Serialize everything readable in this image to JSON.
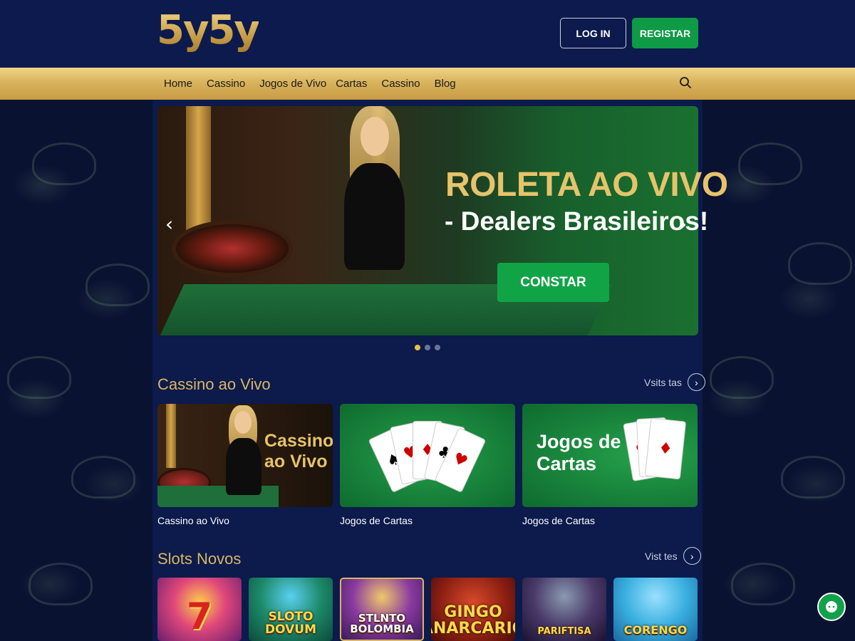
{
  "header": {
    "logo": "5y5y",
    "login_label": "LOG IN",
    "register_label": "REGISTAR"
  },
  "nav": {
    "items": [
      "Home",
      "Cassino",
      "Jogos de Vivo",
      "Cartas",
      "Cassino",
      "Blog"
    ]
  },
  "hero": {
    "title_line1": "ROLETA AO VIVO",
    "title_line2": "- Dealers Brasileiros!",
    "cta_label": "CONSTAR",
    "slides_count": 3,
    "active_slide": 1
  },
  "live_section": {
    "title": "Cassino ao Vivo",
    "view_all": "Vsits tas",
    "cards": [
      {
        "overlay": "Cassino\nao Vivo",
        "label": "Cassino ao Vivo"
      },
      {
        "overlay": "",
        "label": "Jogos de Cartas"
      },
      {
        "overlay": "Jogos de\nCartas",
        "label": "Jogos de Cartas"
      }
    ]
  },
  "slots_section": {
    "title": "Slots Novos",
    "view_all": "Vist tes",
    "slots": [
      {
        "name": "7"
      },
      {
        "name": "SLOTO\nDOVUM"
      },
      {
        "name": "STLNTO\nBOLOMBIA"
      },
      {
        "name": "GINGO\nCANARCARIOS"
      },
      {
        "name": "PARIFTISA"
      },
      {
        "name": "CORENGO"
      }
    ]
  },
  "colors": {
    "gold": "#d9b760",
    "green_button": "#0f9a45",
    "navy": "#0d1a4d"
  }
}
